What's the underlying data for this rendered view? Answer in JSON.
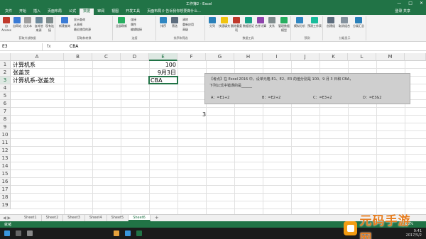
{
  "window": {
    "title": "工作簿2 - Excel",
    "controls": [
      "—",
      "□",
      "✕"
    ]
  },
  "ribbon_tabs": [
    "文件",
    "开始",
    "插入",
    "页面布局",
    "公式",
    "数据",
    "审阅",
    "视图",
    "开发工具",
    "页面布局"
  ],
  "active_tab_index": 5,
  "tell_me": "♀ 告诉我你想要做什么...",
  "sign_in": "登录  共享",
  "ribbon": {
    "groups": [
      {
        "label": "获取外部数据",
        "buttons": [
          "自Access",
          "自网站",
          "自文本",
          "自其他来源",
          "现有连接"
        ]
      },
      {
        "label": "获取和转换",
        "buttons": [
          "新建查询"
        ],
        "small": [
          "显示查询",
          "从表格",
          "最近使用的源"
        ]
      },
      {
        "label": "连接",
        "buttons": [
          "全部刷新"
        ],
        "small": [
          "连接",
          "属性",
          "编辑链接"
        ]
      },
      {
        "label": "排序和筛选",
        "buttons": [
          "排序",
          "筛选"
        ],
        "small": [
          "清除",
          "重新应用",
          "高级"
        ]
      },
      {
        "label": "数据工具",
        "buttons": [
          "分列",
          "快速填充",
          "删除重复项",
          "数据验证",
          "合并计算",
          "关系",
          "管理数据模型"
        ]
      },
      {
        "label": "预测",
        "buttons": [
          "模拟分析",
          "预测工作表"
        ]
      },
      {
        "label": "分级显示",
        "buttons": [
          "创建组",
          "取消组合",
          "分类汇总"
        ]
      }
    ]
  },
  "formula_bar": {
    "name_box": "E3",
    "fx": "fx",
    "value": "CBA"
  },
  "columns": [
    "A",
    "B",
    "C",
    "D",
    "E",
    "F",
    "G",
    "H",
    "I",
    "J",
    "K",
    "L",
    "M"
  ],
  "rows": [
    "1",
    "2",
    "3",
    "4",
    "5",
    "6",
    "7",
    "8",
    "9",
    "10",
    "11",
    "12",
    "13",
    "14",
    "15",
    "16",
    "17",
    "18",
    "19"
  ],
  "selected_column": "E",
  "selected_row": "3",
  "cells": {
    "A1": "计算机系",
    "E1": "100",
    "A2": "张盖茨",
    "E2": "9月3日",
    "A3": "计算机系-张盖茨",
    "E3": "CBA"
  },
  "quiz_image": {
    "line1": "【考点】在 Excel 2016 中，设单元格 E1、E2、E3 的值分别是 100、9 月 3 日和 CBA，",
    "line2": "下列公式中错误的是______",
    "options": [
      "A：=E1+2",
      "B：=E2+2",
      "C：=E3+2",
      "D：=E3&2"
    ]
  },
  "stray_text": "3",
  "sheets": [
    "Sheet1",
    "Sheet2",
    "Sheet3",
    "Sheet4",
    "Sheet5",
    "Sheet6"
  ],
  "active_sheet_index": 5,
  "add_sheet": "+",
  "status": {
    "ready": "就绪",
    "zoom": "100%"
  },
  "taskbar_clock": {
    "time": "9:41",
    "date": "2017/5/2"
  },
  "watermark": "元码手游网",
  "colors": {
    "excel_green": "#217346",
    "watermark_orange": "#e67e22"
  }
}
